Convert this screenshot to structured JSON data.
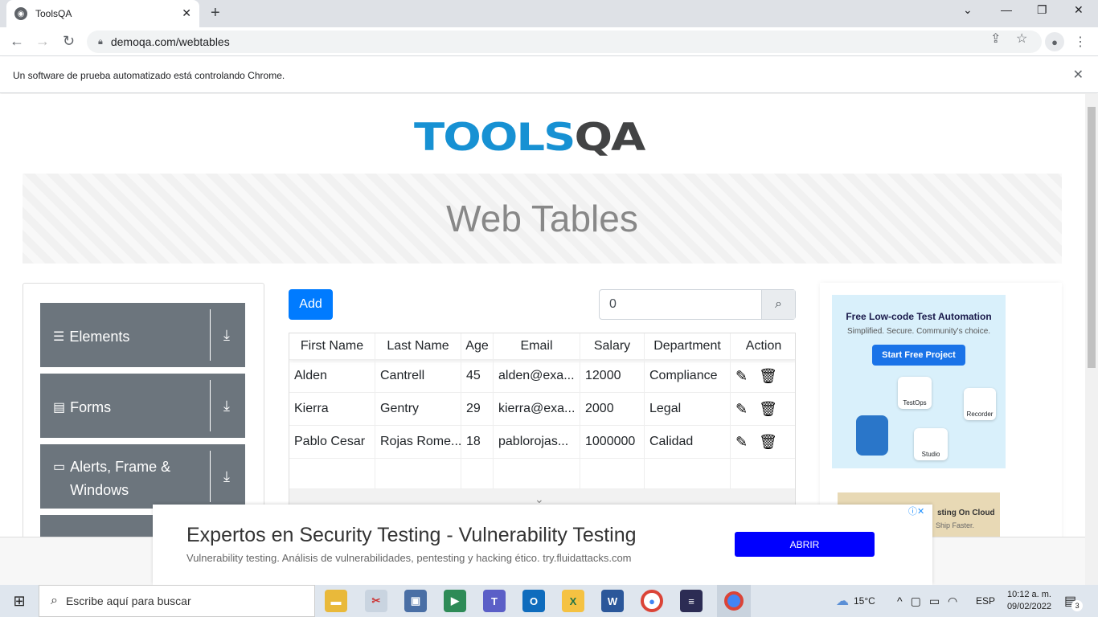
{
  "browser": {
    "tab_title": "ToolsQA",
    "url": "demoqa.com/webtables",
    "infobar_text": "Un software de prueba automatizado está controlando Chrome."
  },
  "page": {
    "logo_left": "TOOLS",
    "logo_right": "QA",
    "banner_title": "Web Tables",
    "sidebar_groups": [
      {
        "label": "Elements",
        "icon": "hamburger-icon"
      },
      {
        "label": "Forms",
        "icon": "document-icon"
      },
      {
        "label": "Alerts, Frame & Windows",
        "icon": "window-icon"
      }
    ],
    "add_label": "Add",
    "search_value": "0",
    "table": {
      "headers": [
        "First Name",
        "Last Name",
        "Age",
        "Email",
        "Salary",
        "Department",
        "Action"
      ],
      "rows": [
        [
          "Alden",
          "Cantrell",
          "45",
          "alden@exa...",
          "12000",
          "Compliance"
        ],
        [
          "Kierra",
          "Gentry",
          "29",
          "kierra@exa...",
          "2000",
          "Legal"
        ],
        [
          "Pablo Cesar",
          "Rojas Rome...",
          "18",
          "pablorojas...",
          "1000000",
          "Calidad"
        ]
      ]
    }
  },
  "side_ad": {
    "headline": "Free Low-code Test Automation",
    "subline": "Simplified. Secure. Community's choice.",
    "cta": "Start Free Project",
    "badges": [
      "TestOps",
      "Recorder",
      "Studio"
    ],
    "second_ad_text": "sting On Cloud",
    "second_ad_sub": "Ship Faster."
  },
  "bottom_ad": {
    "title": "Expertos en Security Testing - Vulnerability Testing",
    "description": "Vulnerability testing. Análisis de vulnerabilidades, pentesting y hacking ético. try.fluidattacks.com",
    "cta": "ABRIR"
  },
  "taskbar": {
    "search_placeholder": "Escribe aquí para buscar",
    "temperature": "15°C",
    "language": "ESP",
    "time": "10:12 a. m.",
    "date": "09/02/2022",
    "notifications": "3"
  },
  "colors": {
    "accent": "#007bff",
    "sidebar_group": "#6c757d",
    "logo_blue": "#1791d3",
    "logo_dark": "#424344",
    "ad_button": "#0000ff"
  }
}
